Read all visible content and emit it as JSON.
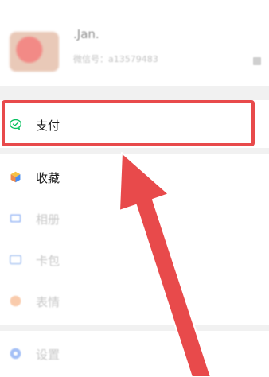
{
  "profile": {
    "name": ".Jan.",
    "wechat_id": "微信号：a13579483"
  },
  "menu": [
    {
      "label": "支付"
    },
    {
      "label": "收藏"
    },
    {
      "label": "相册"
    },
    {
      "label": "卡包"
    },
    {
      "label": "表情"
    },
    {
      "label": "设置"
    }
  ],
  "colors": {
    "annotation_red": "#e84a4b",
    "pay_green": "#07c160"
  }
}
